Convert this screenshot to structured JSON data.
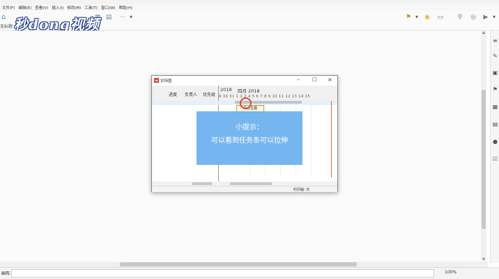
{
  "window": {
    "title": ""
  },
  "menu": [
    "文件(F)",
    "编辑(E)",
    "查看(V)",
    "插入(I)",
    "修改(M)",
    "工具(T)",
    "窗口(W)",
    "帮助(H)"
  ],
  "toolbar": {
    "tab_label": "无标题",
    "more": "⋯"
  },
  "watermark": "秒dong视频",
  "dialog": {
    "title": "甘特图",
    "columns": [
      "进度",
      "负责人",
      "优先级"
    ],
    "year": "2018",
    "month": "四月 2018",
    "days": "9 30 31 1 2 3 4 5 6 7 8 9 10 11 12 13 14 15",
    "task_label": "中心主题",
    "timeline_label": "时间轴: 天"
  },
  "tip": {
    "heading": "小提示：",
    "body": "可以看到任务条可以拉伸"
  },
  "status": {
    "page": "画布 1",
    "zoom": "100%"
  },
  "colors": {
    "accent": "#4a86c8",
    "tip_bg": "#6fb3f0",
    "today_line": "#d9653a",
    "cursor": "#e14a35"
  }
}
